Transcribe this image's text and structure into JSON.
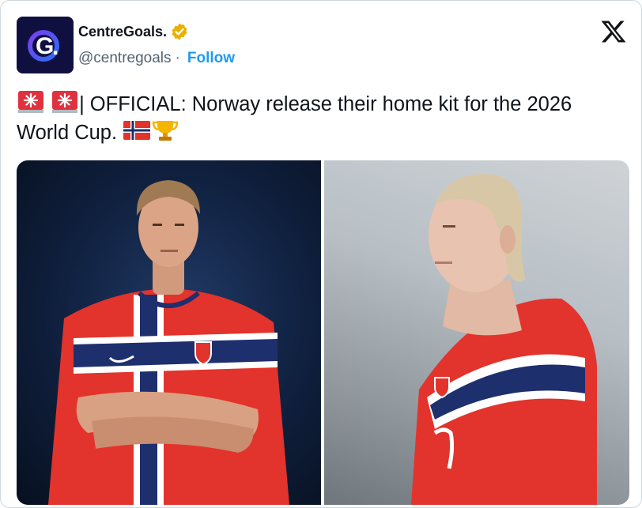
{
  "author": {
    "display_name": "CentreGoals.",
    "handle": "@centregoals",
    "separator": "·",
    "follow_label": "Follow",
    "avatar_letter": "G",
    "avatar_dot": "."
  },
  "post": {
    "text_main": "| OFFICIAL: Norway release their home kit for the 2026 World Cup.",
    "emojis": [
      "rotating-light-icon",
      "rotating-light-icon",
      "norway-flag-icon",
      "trophy-icon"
    ]
  },
  "media": [
    {
      "subject": "player with arms crossed wearing Norway home kit",
      "icon": "photo"
    },
    {
      "subject": "player in side profile wearing Norway home kit",
      "icon": "photo"
    }
  ],
  "colors": {
    "accent": "#1d9bf0",
    "text": "#0f1419",
    "muted": "#536471",
    "badge": "#e8b100",
    "kit_red": "#e3332d",
    "kit_navy": "#1e2f6e"
  }
}
